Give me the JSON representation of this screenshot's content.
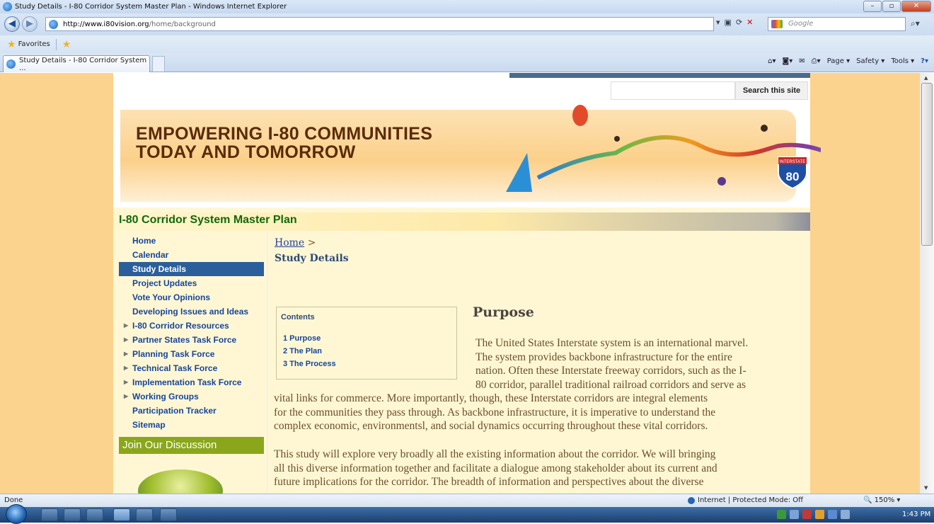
{
  "window": {
    "title": "Study Details - I-80 Corridor System Master Plan - Windows Internet Explorer"
  },
  "address": {
    "url_host": "http://www.i80vision.org",
    "url_path": "/home/background",
    "search_placeholder": "Google"
  },
  "favorites": {
    "label": "Favorites"
  },
  "tab": {
    "label": "Study Details - I-80 Corridor System ..."
  },
  "commandbar": {
    "page": "Page",
    "safety": "Safety",
    "tools": "Tools"
  },
  "site": {
    "search_button": "Search this site",
    "headline_line1": "EMPOWERING I-80 COMMUNITIES",
    "headline_line2": "TODAY AND TOMORROW",
    "shield_number": "80",
    "shield_label": "INTERSTATE",
    "title": "I-80 Corridor System Master Plan"
  },
  "nav": {
    "items": [
      {
        "label": "Home",
        "expandable": false,
        "active": false
      },
      {
        "label": "Calendar",
        "expandable": false,
        "active": false
      },
      {
        "label": "Study Details",
        "expandable": false,
        "active": true
      },
      {
        "label": "Project Updates",
        "expandable": false,
        "active": false
      },
      {
        "label": "Vote Your Opinions",
        "expandable": false,
        "active": false
      },
      {
        "label": "Developing Issues and Ideas",
        "expandable": false,
        "active": false
      },
      {
        "label": "I-80 Corridor Resources",
        "expandable": true,
        "active": false
      },
      {
        "label": "Partner States Task Force",
        "expandable": true,
        "active": false
      },
      {
        "label": "Planning Task Force",
        "expandable": true,
        "active": false
      },
      {
        "label": "Technical Task Force",
        "expandable": true,
        "active": false
      },
      {
        "label": "Implementation Task Force",
        "expandable": true,
        "active": false
      },
      {
        "label": "Working Groups",
        "expandable": true,
        "active": false
      },
      {
        "label": "Participation Tracker",
        "expandable": false,
        "active": false
      },
      {
        "label": "Sitemap",
        "expandable": false,
        "active": false
      }
    ],
    "join": "Join Our Discussion"
  },
  "content": {
    "breadcrumb_home": "Home",
    "breadcrumb_sep": ">",
    "heading": "Study Details",
    "toc_title": "Contents",
    "toc": [
      "1 Purpose",
      "2 The Plan",
      "3 The Process"
    ],
    "purpose_heading": "Purpose",
    "para1_lines": [
      "The United States Interstate system is an international marvel.",
      "The system provides backbone infrastructure for the entire",
      "nation. Often these Interstate freeway corridors, such as the I-",
      "80 corridor, parallel traditional railroad corridors and serve as"
    ],
    "para1_full_lines": [
      "vital links for commerce. More importantly, though, these Interstate corridors are integral elements",
      "for the communities they pass through. As backbone infrastructure, it is imperative to understand the",
      "complex economic, environmentsl, and social dynamics occurring throughout these vital corridors."
    ],
    "para2_lines": [
      "This study will explore very broadly all the existing information about the corridor. We will bringing",
      "all this diverse information together and facilitate a dialogue among stakeholder about its current and",
      "future implications for the corridor. The breadth of information and perspectives about the diverse"
    ]
  },
  "status": {
    "left": "Done",
    "zone": "Internet | Protected Mode: Off",
    "zoom": "150%"
  },
  "taskbar": {
    "clock": "1:43 PM"
  },
  "colors": {
    "page_bg": "#fbd38e",
    "content_bg": "#fff7d4",
    "nav_active": "#2b5f9b",
    "nav_link": "#16459a",
    "site_title": "#12680c",
    "join_bg": "#8aa71b"
  }
}
